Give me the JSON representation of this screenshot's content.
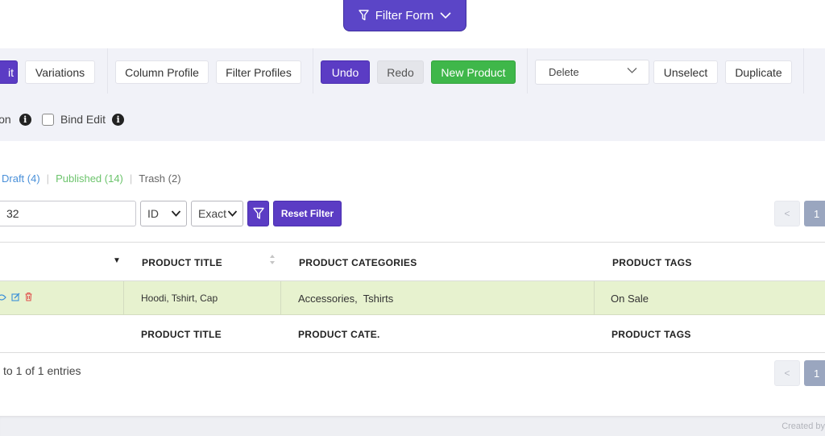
{
  "filter_form": {
    "label": "Filter Form"
  },
  "toolbar": {
    "edit_label": "it",
    "variations_label": "Variations",
    "column_profile_label": "Column Profile",
    "filter_profiles_label": "Filter Profiles",
    "undo_label": "Undo",
    "redo_label": "Redo",
    "new_product_label": "New Product",
    "bulk_action_selected": "Delete",
    "unselect_label": "Unselect",
    "duplicate_label": "Duplicate"
  },
  "options": {
    "option_partial_label": "ion",
    "bind_edit_label": "Bind Edit",
    "info_glyph": "i"
  },
  "status_links": {
    "draft": "Draft (4)",
    "published": "Published (14)",
    "trash": "Trash (2)",
    "separator": "|"
  },
  "filter": {
    "search_value": "32",
    "field_select": "ID",
    "match_select": "Exact",
    "reset_label": "Reset Filter"
  },
  "pagination": {
    "prev": "<",
    "current": "1"
  },
  "table": {
    "headers": {
      "title": "PRODUCT TITLE",
      "categories": "PRODUCT CATEGORIES",
      "tags": "PRODUCT TAGS"
    },
    "sort_glyph": "▼",
    "rows": [
      {
        "title": "Hoodi, Tshirt, Cap",
        "categories": "Accessories,  Tshirts",
        "tags": "On Sale"
      }
    ],
    "footer": {
      "title": "PRODUCT TITLE",
      "categories": "PRODUCT CATE.",
      "tags": "PRODUCT TAGS"
    }
  },
  "entries_info": "to 1 of 1 entries",
  "created_by": "Created by",
  "colors": {
    "accent_purple": "#5b3cc4",
    "green": "#3fb74a",
    "row_highlight": "#e7f2cf"
  }
}
